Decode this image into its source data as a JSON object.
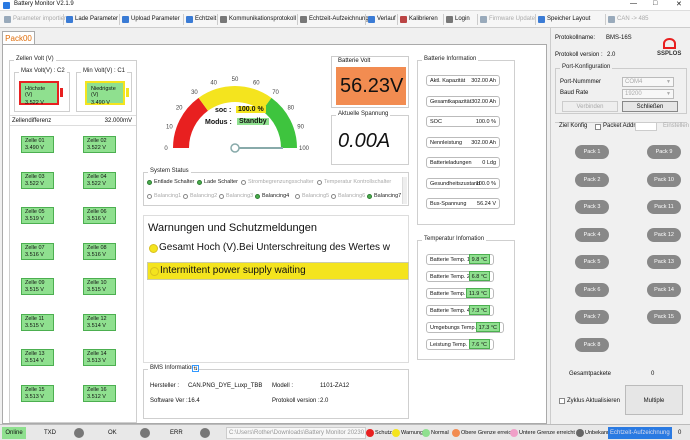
{
  "window": {
    "title": "Battery Monitor V2.1.9"
  },
  "toolbar": {
    "items": [
      {
        "label": "Parameter importieren",
        "disabled": true,
        "color": "#9ab"
      },
      {
        "label": "Lade Parameter",
        "disabled": false,
        "color": "#3a7bd5"
      },
      {
        "label": "Upload Parameter",
        "disabled": false,
        "color": "#3a7bd5"
      },
      {
        "label": "Echtzeit",
        "disabled": false,
        "color": "#3a7bd5"
      },
      {
        "label": "Kommunikationsprotokoll",
        "disabled": false,
        "color": "#777"
      },
      {
        "label": "Echtzeit-Aufzeichnung",
        "disabled": false,
        "color": "#777"
      },
      {
        "label": "Verlauf",
        "disabled": false,
        "color": "#3a7bd5"
      },
      {
        "label": "Kalibrieren",
        "disabled": false,
        "color": "#b44"
      },
      {
        "label": "Login",
        "disabled": false,
        "color": "#777"
      },
      {
        "label": "Firmware Update",
        "disabled": true,
        "color": "#9ab"
      },
      {
        "label": "Speicher Layout",
        "disabled": false,
        "color": "#3a7bd5"
      },
      {
        "label": "CAN -> 485",
        "disabled": true,
        "color": "#9ab"
      }
    ]
  },
  "tab": {
    "label": "Pack00"
  },
  "cells_group": {
    "label": "Zellen Volt (V)",
    "max_label": "Max Volt(V) : C2",
    "min_label": "Min Volt(V) : C1",
    "max_title": "Höchste (V)",
    "max_value": "3.522 V",
    "min_title": "Niedrigste (V)",
    "min_value": "3.490 V",
    "diff_label": "Zellendifferenz",
    "diff_value": "32.000mV",
    "cells": [
      {
        "name": "Zelle 01",
        "value": "3.490 V"
      },
      {
        "name": "Zelle 02",
        "value": "3.522 V"
      },
      {
        "name": "Zelle 03",
        "value": "3.522 V"
      },
      {
        "name": "Zelle 04",
        "value": "3.522 V"
      },
      {
        "name": "Zelle 05",
        "value": "3.519 V"
      },
      {
        "name": "Zelle 06",
        "value": "3.516 V"
      },
      {
        "name": "Zelle 07",
        "value": "3.516 V"
      },
      {
        "name": "Zelle 08",
        "value": "3.516 V"
      },
      {
        "name": "Zelle 09",
        "value": "3.515 V"
      },
      {
        "name": "Zelle 10",
        "value": "3.515 V"
      },
      {
        "name": "Zelle 11",
        "value": "3.515 V"
      },
      {
        "name": "Zelle 12",
        "value": "3.514 V"
      },
      {
        "name": "Zelle 13",
        "value": "3.514 V"
      },
      {
        "name": "Zelle 14",
        "value": "3.513 V"
      },
      {
        "name": "Zelle 15",
        "value": "3.513 V"
      },
      {
        "name": "Zelle 16",
        "value": "3.512 V"
      }
    ]
  },
  "gauge": {
    "ticks": [
      "0",
      "10",
      "20",
      "30",
      "40",
      "50",
      "60",
      "70",
      "80",
      "90",
      "100"
    ],
    "soc_label": "soc :",
    "soc_value": "100.0 %",
    "soc_fraction": 1.0,
    "mode_label": "Modus :",
    "mode_value": "Standby",
    "colors": {
      "red": "#e82020",
      "yellow": "#f4e41e",
      "green": "#3ec43e"
    }
  },
  "battery_volt": {
    "label": "Batterie Volt",
    "value": "56.23V",
    "color": "#f28c51"
  },
  "current": {
    "label": "Aktuelle Spannung",
    "value": "0.00A"
  },
  "system_status": {
    "label": "System Status",
    "row1": [
      {
        "label": "Entlade Schalter",
        "state": "on"
      },
      {
        "label": "Lade Schalter",
        "state": "on"
      },
      {
        "label": "Strombegrenzungsschalter",
        "state": "off"
      },
      {
        "label": "Temperatur Kontrollschalter",
        "state": "off"
      }
    ],
    "row2": [
      {
        "label": "Balancing1",
        "state": "off"
      },
      {
        "label": "Balancing2",
        "state": "off"
      },
      {
        "label": "Balancing3",
        "state": "off"
      },
      {
        "label": "Balancing4",
        "state": "on"
      },
      {
        "label": "Balancing5",
        "state": "off"
      },
      {
        "label": "Balancing6",
        "state": "off"
      },
      {
        "label": "Balancing7",
        "state": "on"
      }
    ]
  },
  "warnings": {
    "label": "Warnungen und Schutzmeldungen",
    "items": [
      "Gesamt Hoch (V).Bei Unterschreitung des Wertes w",
      "Intermittent power supply waiting"
    ]
  },
  "bms_info": {
    "label": "BMS Information",
    "hersteller_label": "Hersteller :",
    "hersteller_value": "CAN.PNG_DYE_Luxp_TBB",
    "modell_label": "Modell :",
    "modell_value": "1101-ZA12",
    "sw_label": "Software Ver :",
    "sw_value": "16.4",
    "protokoll_label": "Protokoll version :",
    "protokoll_value": "2.0"
  },
  "battery_info": {
    "label": "Batterie Information",
    "rows": [
      {
        "label": "Aktl. Kapazität",
        "value": "302.00 Ah"
      },
      {
        "label": "Gesamtkapazität",
        "value": "302.00 Ah"
      },
      {
        "label": "SOC",
        "value": "100.0 %"
      },
      {
        "label": "Nennleistung",
        "value": "302.00 Ah"
      },
      {
        "label": "Batterieladungen",
        "value": "0 Ldg"
      },
      {
        "label": "Gesundheitszustand",
        "value": "100.0 %"
      },
      {
        "label": "Bus-Spannung",
        "value": "56.24 V"
      }
    ]
  },
  "temp_info": {
    "label": "Temperatur Infomation",
    "rows": [
      {
        "label": "Batterie Temp. 1",
        "value": "9.8 °C"
      },
      {
        "label": "Batterie Temp. 2",
        "value": "6.8 °C"
      },
      {
        "label": "Batterie Temp. 3",
        "value": "11.9 °C"
      },
      {
        "label": "Batterie Temp. 4",
        "value": "7.3 °C"
      },
      {
        "label": "Umgebungs Temp.",
        "value": "17.3 °C"
      },
      {
        "label": "Leistung Temp.",
        "value": "7.6 °C"
      }
    ]
  },
  "side": {
    "protokollname_label": "Protokollname:",
    "protokollname_value": "BMS-16S",
    "protokollversion_label": "Protokoll version :",
    "protokollversion_value": "2.0",
    "logo_text": "SSPLOS",
    "port_label": "Port-Konfiguration",
    "port_nummer_label": "Port-Nummmer",
    "port_nummer_value": "COM4",
    "baud_label": "Baud Rate",
    "baud_value": "19200",
    "connect_label": "Verbinden",
    "close_label": "Schließen",
    "ziel_label": "Ziel Konfig",
    "packet_label": "Packet Addr:",
    "einstellen_label": "Einstellen",
    "packs": [
      "Pack 1",
      "Pack 9",
      "Pack 2",
      "Pack 10",
      "Pack 3",
      "Pack 11",
      "Pack 4",
      "Pack 12",
      "Pack 5",
      "Pack 13",
      "Pack 6",
      "Pack 14",
      "Pack 7",
      "Pack 15",
      "Pack 8"
    ],
    "gesamt_label": "Gesamtpackete",
    "gesamt_value": "0",
    "zyklus_label": "Zyklus Aktualisieren",
    "multiple_label": "Multiple"
  },
  "statusbar": {
    "online": "Online",
    "txd": "TXD",
    "ok": "OK",
    "err": "ERR",
    "path": "C:\\Users\\Rother\\Downloads\\Battery Monitor 20230",
    "legend": [
      {
        "label": "Schutz",
        "color": "#e82020"
      },
      {
        "label": "Warnung",
        "color": "#f4e41e"
      },
      {
        "label": "Normal",
        "color": "#8fe08f"
      },
      {
        "label": "Obere Grenze erreicht",
        "color": "#f28c51"
      },
      {
        "label": "Untere Grenze erreicht",
        "color": "#f0a0c8"
      },
      {
        "label": "Unbekannt",
        "color": "#666666"
      }
    ],
    "recording": "Echtzeit-Aufzeichnung",
    "time": "0"
  }
}
